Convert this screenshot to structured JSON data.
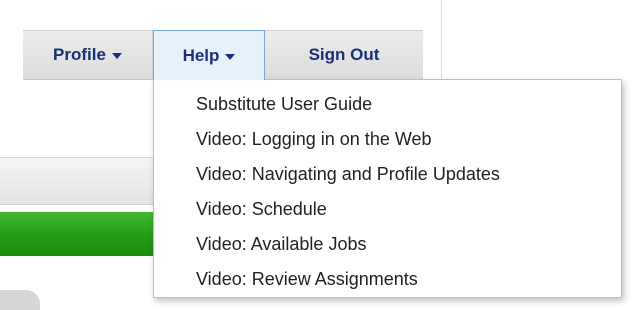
{
  "nav": {
    "profile_label": "Profile",
    "help_label": "Help",
    "signout_label": "Sign Out",
    "caret_icon": "caret-down-icon"
  },
  "help_menu": {
    "items": [
      "Substitute User Guide",
      "Video: Logging in on the Web",
      "Video: Navigating and Profile Updates",
      "Video: Schedule",
      "Video: Available Jobs",
      "Video: Review Assignments"
    ]
  },
  "colors": {
    "nav_text": "#1a2f7a",
    "active_tab_bg": "#e7f1fb",
    "active_tab_border": "#7aa7dc",
    "green_bar": "#249c17"
  }
}
